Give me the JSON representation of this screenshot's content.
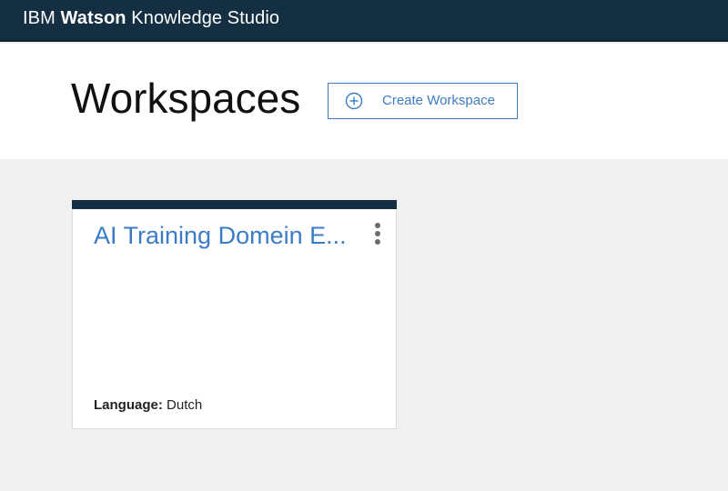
{
  "topbar": {
    "brand_prefix": "IBM",
    "brand_bold": "Watson",
    "brand_suffix": "Knowledge Studio"
  },
  "header": {
    "title": "Workspaces",
    "create_button_label": "Create Workspace",
    "create_button_icon": "plus-circle-icon"
  },
  "workspaces": [
    {
      "title": "AI Training Domein E...",
      "language_label": "Language:",
      "language_value": "Dutch",
      "menu_icon": "overflow-menu-vertical-icon"
    }
  ],
  "colors": {
    "topbar_bg": "#152f42",
    "accent": "#3b7cc4",
    "page_bg": "#f0f0f0"
  }
}
